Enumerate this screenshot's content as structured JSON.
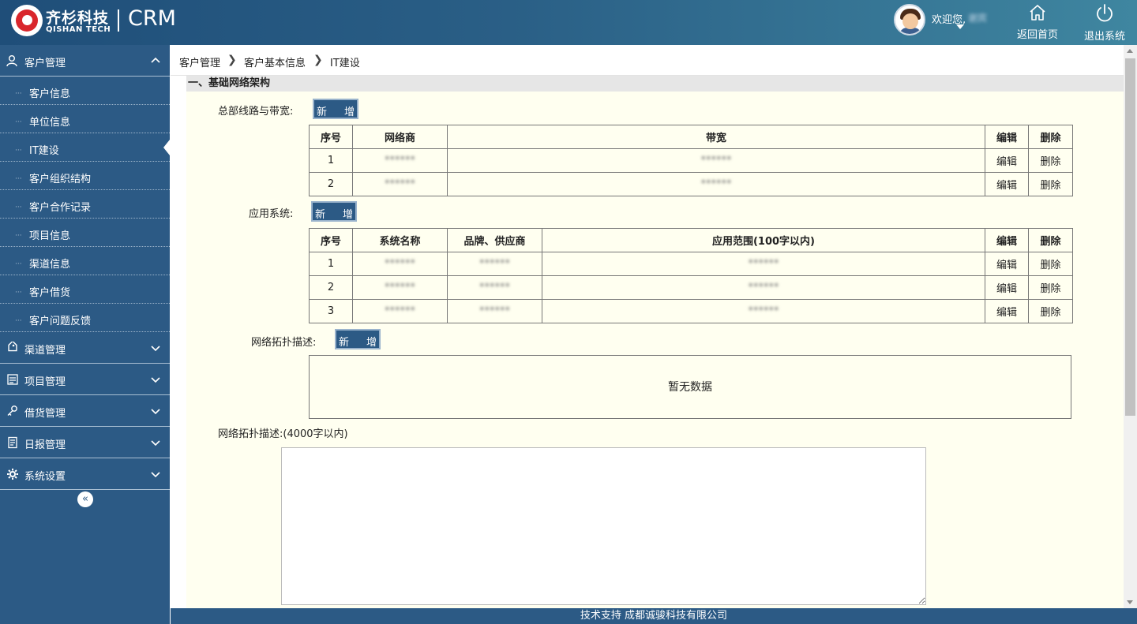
{
  "header": {
    "brand_cn": "齐杉科技",
    "brand_en": "QISHAN TECH",
    "app": "CRM",
    "welcome": "欢迎您,",
    "user_name": "谢宾",
    "home_label": "返回首页",
    "logout_label": "退出系统"
  },
  "sidebar": {
    "customer_mgmt": "客户管理",
    "sub_items": [
      "客户信息",
      "单位信息",
      "IT建设",
      "客户组织结构",
      "客户合作记录",
      "项目信息",
      "渠道信息",
      "客户借货",
      "客户问题反馈"
    ],
    "active_item": "IT建设",
    "groups": [
      "渠道管理",
      "项目管理",
      "借货管理",
      "日报管理",
      "系统设置"
    ],
    "collapse": "«"
  },
  "breadcrumb": [
    "客户管理",
    "客户基本信息",
    "IT建设"
  ],
  "content": {
    "section_title": "一、基础网络架构",
    "add_a": "新",
    "add_b": "增",
    "hq_label": "总部线路与带宽:",
    "hq_table": {
      "headers": [
        "序号",
        "网络商",
        "带宽",
        "编辑",
        "删除"
      ],
      "rows": [
        [
          "1",
          "******",
          "******",
          "编辑",
          "删除"
        ],
        [
          "2",
          "******",
          "******",
          "编辑",
          "删除"
        ]
      ]
    },
    "app_label": "应用系统:",
    "app_table": {
      "headers": [
        "序号",
        "系统名称",
        "品牌、供应商",
        "应用范围(100字以内)",
        "编辑",
        "删除"
      ],
      "rows": [
        [
          "1",
          "******",
          "******",
          "******",
          "编辑",
          "删除"
        ],
        [
          "2",
          "******",
          "******",
          "******",
          "编辑",
          "删除"
        ],
        [
          "3",
          "******",
          "******",
          "******",
          "编辑",
          "删除"
        ]
      ]
    },
    "topo_label": "网络拓扑描述:",
    "no_data": "暂无数据",
    "topo_desc_label": "网络拓扑描述:(4000字以内)"
  },
  "footer": "技术支持 成都诚骏科技有限公司"
}
